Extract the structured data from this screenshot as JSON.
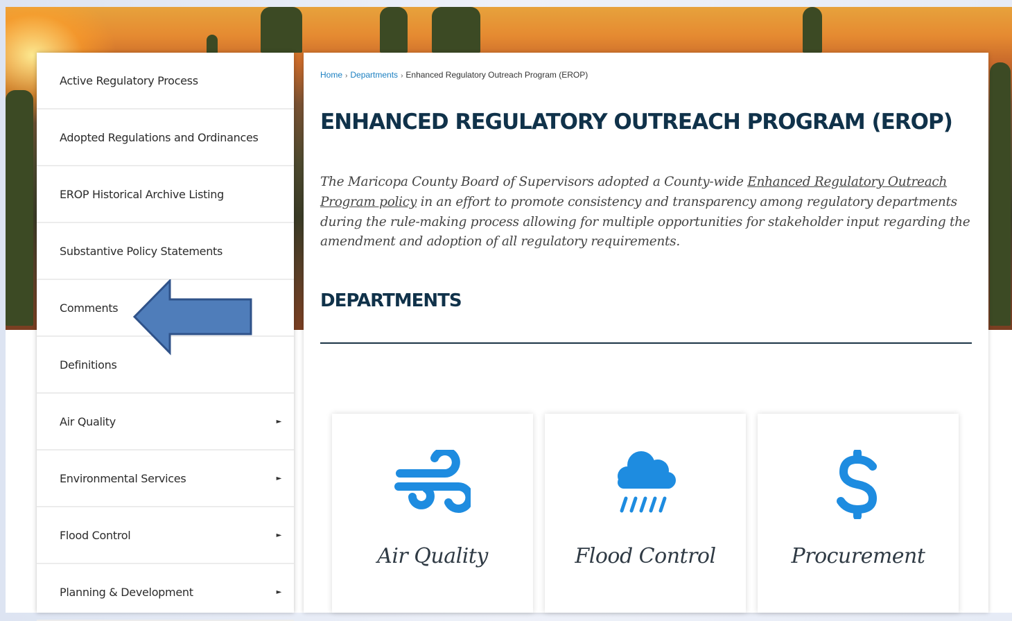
{
  "sidebar": {
    "items": [
      {
        "label": "Active Regulatory Process",
        "has_submenu": false
      },
      {
        "label": "Adopted Regulations and Ordinances",
        "has_submenu": false
      },
      {
        "label": "EROP Historical Archive Listing",
        "has_submenu": false
      },
      {
        "label": "Substantive Policy Statements",
        "has_submenu": false
      },
      {
        "label": "Comments",
        "has_submenu": false
      },
      {
        "label": "Definitions",
        "has_submenu": false
      },
      {
        "label": "Air Quality",
        "has_submenu": true
      },
      {
        "label": "Environmental Services",
        "has_submenu": true
      },
      {
        "label": "Flood Control",
        "has_submenu": true
      },
      {
        "label": "Planning & Development",
        "has_submenu": true
      }
    ],
    "caret_glyph": "►"
  },
  "breadcrumb": {
    "home": "Home",
    "separator": "›",
    "departments": "Departments",
    "current": "Enhanced Regulatory Outreach Program (EROP)"
  },
  "main": {
    "title": "ENHANCED REGULATORY OUTREACH PROGRAM (EROP)",
    "intro_before_link": "The Maricopa County Board of Supervisors adopted a County-wide ",
    "intro_link": "Enhanced Regulatory Outreach Program policy",
    "intro_after_link": " in an effort to promote consistency and transparency among regulatory departments during the rule-making process allowing for multiple opportunities for stakeholder input regarding the amendment and adoption of all regulatory requirements.",
    "departments_heading": "DEPARTMENTS"
  },
  "cards": [
    {
      "label": "Air Quality",
      "icon": "wind-icon"
    },
    {
      "label": "Flood Control",
      "icon": "rain-cloud-icon"
    },
    {
      "label": "Procurement",
      "icon": "dollar-icon"
    }
  ],
  "colors": {
    "icon_blue": "#1e8ce0",
    "title_navy": "#10324a",
    "link_blue": "#1a7fc1",
    "annotation_arrow": "#4f7dba"
  }
}
